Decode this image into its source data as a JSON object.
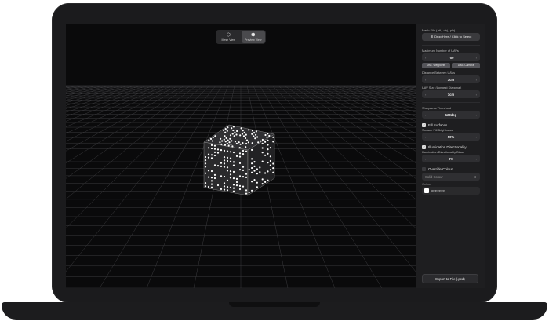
{
  "view_toggle": {
    "mesh_label": "Mesh View",
    "mesh_icon": "cube-icon",
    "preview_label": "Preview View",
    "preview_icon": "preview-cube-icon",
    "active": "preview"
  },
  "panel": {
    "file_label": "Mesh File (.stl, .obj, .ply)",
    "drop_button": "Drop Here / Click to Select",
    "max_uavs_label": "Maximum Number of UAVs",
    "max_uavs_value": "700",
    "show_waypoints": "Disc. Waypoints",
    "show_camera": "Disc. Camera",
    "distance_label": "Distance Between UAVs",
    "distance_value": "3cm",
    "uav_size_label": "UAV Size (Longest Diagonal)",
    "uav_size_value": "7cm",
    "sharpness_label": "Sharpness Threshold",
    "sharpness_value": "120deg",
    "fill_surfaces_label": "Fill Surfaces",
    "fill_surfaces_checked": true,
    "fill_brightness_label": "Surface Fill Brightness",
    "fill_brightness_value": "50%",
    "illumination_label": "Illumination Directionality",
    "illumination_checked": true,
    "illumination_bias_label": "Illumination Directionality Biasd",
    "illumination_bias_value": "0%",
    "override_label": "Override Colour",
    "override_checked": false,
    "colour_mode_value": "Solid Colour",
    "colour_label": "Colour",
    "colour_hex": "#FFFFFF",
    "export_button": "Export to File (.pcd)"
  },
  "colors": {
    "accent": "#ffffff",
    "panel_bg": "#1e1e20",
    "viewport_bg": "#0a0a0b"
  }
}
